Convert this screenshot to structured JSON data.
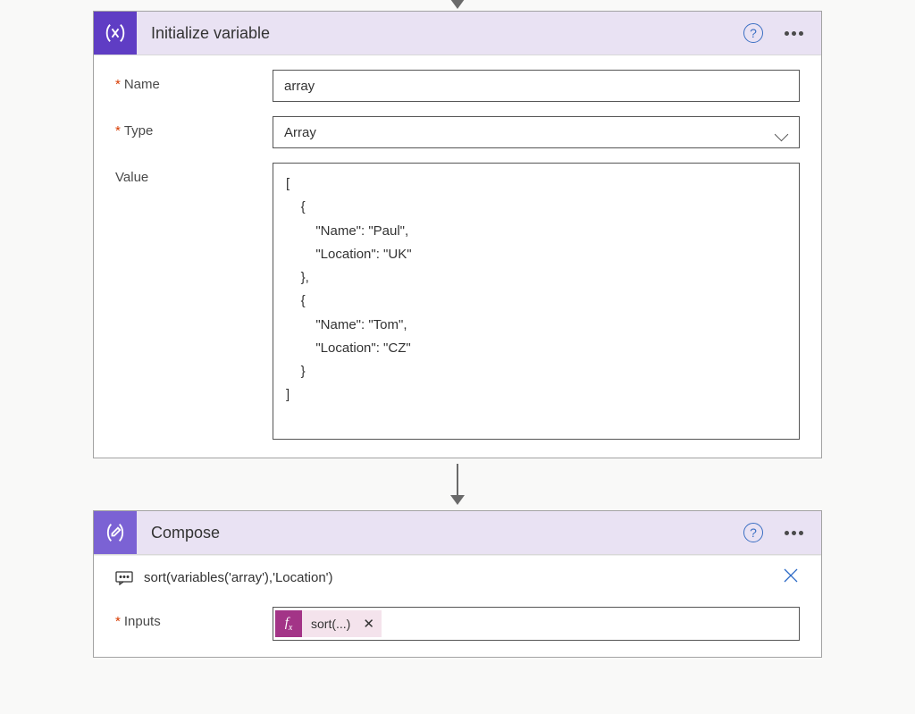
{
  "step1": {
    "title": "Initialize variable",
    "fields": {
      "name_label": "Name",
      "name_value": "array",
      "type_label": "Type",
      "type_value": "Array",
      "value_label": "Value",
      "value_content": "[\n    {\n        \"Name\": \"Paul\",\n        \"Location\": \"UK\"\n    },\n    {\n        \"Name\": \"Tom\",\n        \"Location\": \"CZ\"\n    }\n]"
    }
  },
  "step2": {
    "title": "Compose",
    "peek_expression": "sort(variables('array'),'Location')",
    "inputs_label": "Inputs",
    "token_fx": "fx",
    "token_label": "sort(...)"
  }
}
